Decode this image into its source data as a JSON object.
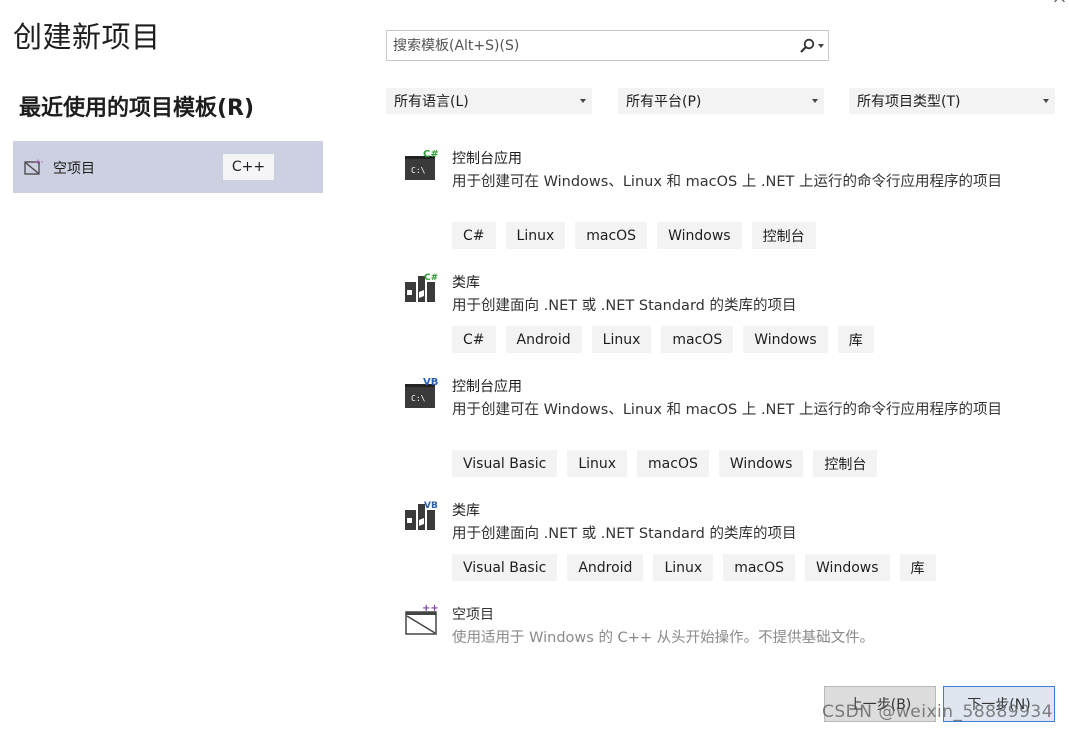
{
  "page": {
    "title": "创建新项目",
    "recent_title": "最近使用的项目模板(R)"
  },
  "recent": [
    {
      "label": "空项目",
      "tag": "C++",
      "icon": "empty-project-icon"
    }
  ],
  "search": {
    "placeholder": "搜索模板(Alt+S)(S)",
    "value": ""
  },
  "filters": {
    "language": "所有语言(L)",
    "platform": "所有平台(P)",
    "project_type": "所有项目类型(T)"
  },
  "templates": [
    {
      "name": "控制台应用",
      "description": "用于创建可在 Windows、Linux 和 macOS 上 .NET 上运行的命令行应用程序的项目",
      "icon": "console-app-csharp-icon",
      "badge": "C#",
      "tags": [
        "C#",
        "Linux",
        "macOS",
        "Windows",
        "控制台"
      ]
    },
    {
      "name": "类库",
      "description": "用于创建面向 .NET 或 .NET Standard 的类库的项目",
      "icon": "class-library-csharp-icon",
      "badge": "C#",
      "tags": [
        "C#",
        "Android",
        "Linux",
        "macOS",
        "Windows",
        "库"
      ]
    },
    {
      "name": "控制台应用",
      "description": "用于创建可在 Windows、Linux 和 macOS 上 .NET 上运行的命令行应用程序的项目",
      "icon": "console-app-vb-icon",
      "badge": "VB",
      "tags": [
        "Visual Basic",
        "Linux",
        "macOS",
        "Windows",
        "控制台"
      ]
    },
    {
      "name": "类库",
      "description": "用于创建面向 .NET 或 .NET Standard 的类库的项目",
      "icon": "class-library-vb-icon",
      "badge": "VB",
      "tags": [
        "Visual Basic",
        "Android",
        "Linux",
        "macOS",
        "Windows",
        "库"
      ]
    },
    {
      "name": "空项目",
      "description": "使用适用于 Windows 的 C++ 从头开始操作。不提供基础文件。",
      "icon": "empty-project-cpp-icon",
      "badge": "++",
      "tags": []
    }
  ],
  "buttons": {
    "back": "上一步(B)",
    "next": "下一步(N)"
  },
  "watermark": "CSDN @weixin_58889934",
  "colors": {
    "selected_row": "#cdd0e0",
    "chip_bg": "#f3f3f3",
    "csharp_badge": "#2e9e3a",
    "vb_badge": "#2a5db0",
    "cpp_badge": "#7b3fa0",
    "next_border": "#3c7fd8"
  }
}
